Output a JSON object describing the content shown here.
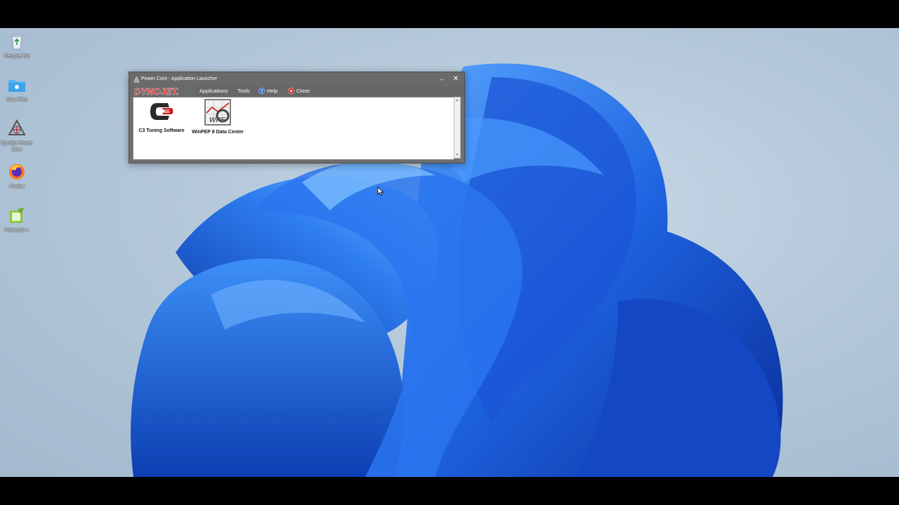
{
  "desktop": {
    "icons": [
      {
        "label": "Recycle Bin",
        "icon": "recycle-bin-icon"
      },
      {
        "label": "Mac Files",
        "icon": "folder-icon"
      },
      {
        "label": "Dynojet Power Core",
        "icon": "power-core-icon"
      },
      {
        "label": "Firefox",
        "icon": "firefox-icon"
      },
      {
        "label": "Notepad++",
        "icon": "notepad-plus-plus-icon"
      }
    ]
  },
  "window": {
    "title": "Power Core - Application Launcher",
    "minimize_glyph": "–",
    "close_glyph": "✕",
    "logo_text": "DYNOJET.",
    "menu": {
      "applications": "Applications",
      "tools": "Tools",
      "help": "Help",
      "close": "Close"
    },
    "apps": [
      {
        "label": "C3 Tuning Software",
        "icon": "c3-logo-icon"
      },
      {
        "label": "WinPEP 8 Data Center",
        "icon": "winpep-8-icon"
      }
    ]
  },
  "colors": {
    "window_chrome": "#6a6a6a",
    "brand_red": "#d21a1a",
    "wallpaper_blue": "#1f5fd8"
  }
}
